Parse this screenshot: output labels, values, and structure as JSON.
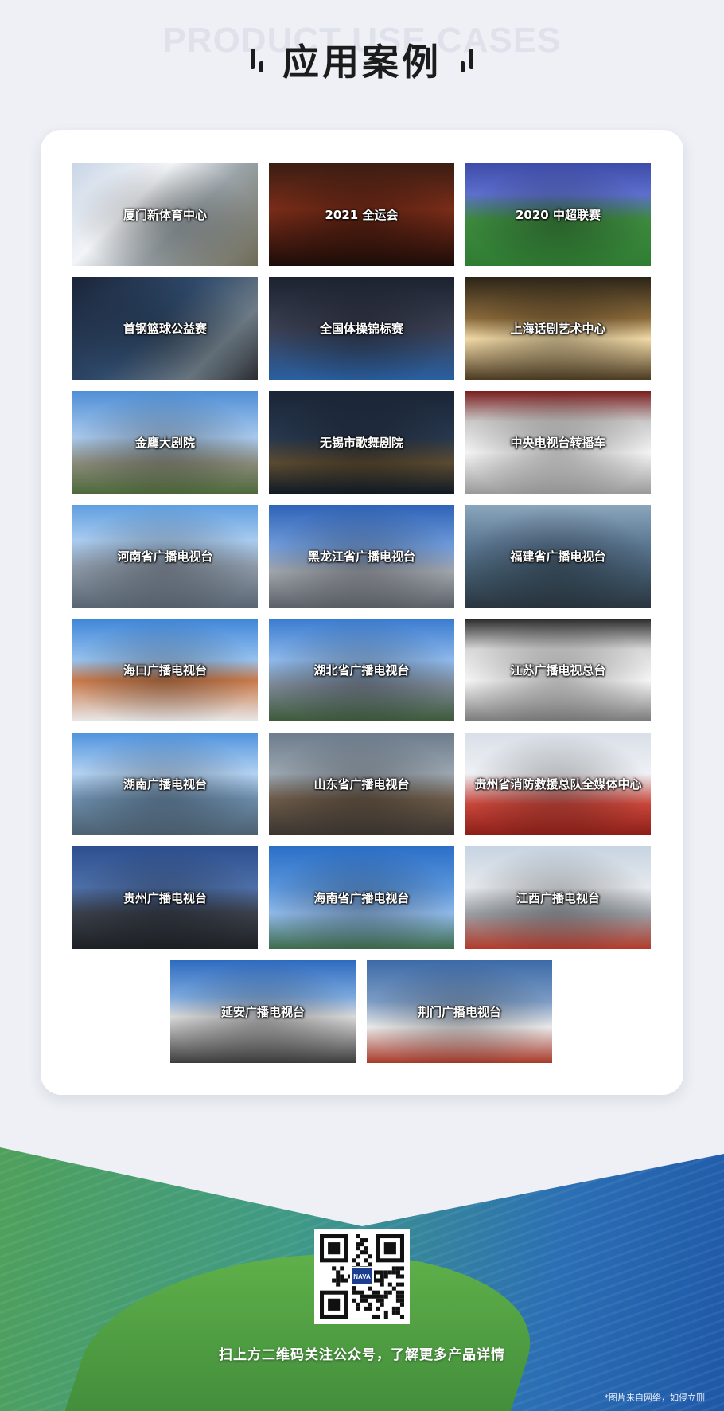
{
  "header": {
    "bg_title": "PRODUCT USE CASES",
    "title": "应用案例"
  },
  "cases": [
    {
      "label": "厦门新体育中心",
      "bg": "linear-gradient(135deg,#c9d6e6 0%,#f2f4f7 35%,#9aa3a8 60%,#6e6a55 100%)",
      "icon": "stadium-photo-icon"
    },
    {
      "label": "2021 全运会",
      "bg": "linear-gradient(180deg,#3b1d12 0%,#7a2c18 45%,#1c0c08 100%)",
      "icon": "national-games-photo-icon"
    },
    {
      "label": "2020 中超联赛",
      "bg": "linear-gradient(180deg,#3e4ca8 0%,#5d6ecd 30%,#3d8a3e 55%,#2f7d33 100%)",
      "icon": "football-match-photo-icon"
    },
    {
      "label": "首钢篮球公益赛",
      "bg": "linear-gradient(135deg,#1b2438 0%,#2f4a6b 45%,#6d7b86 75%,#2a2c30 100%)",
      "icon": "broadcast-console-photo-icon"
    },
    {
      "label": "全国体操锦标赛",
      "bg": "linear-gradient(180deg,#1d2230 0%,#3a3f52 50%,#2a5fa0 100%)",
      "icon": "gymnastics-photo-icon"
    },
    {
      "label": "上海话剧艺术中心",
      "bg": "linear-gradient(180deg,#2b2418 0%,#8b6a3a 40%,#f1d9a6 60%,#4a3a22 100%)",
      "icon": "theater-building-photo-icon"
    },
    {
      "label": "金鹰大剧院",
      "bg": "linear-gradient(180deg,#4f8fd6 0%,#a7c8ec 45%,#8a8a7a 70%,#4d6a3a 100%)",
      "icon": "eagle-statue-photo-icon"
    },
    {
      "label": "无锡市歌舞剧院",
      "bg": "linear-gradient(180deg,#1a2536 0%,#27374d 45%,#5a4a30 70%,#0f1a26 100%)",
      "icon": "night-city-photo-icon"
    },
    {
      "label": "中央电视台转播车",
      "bg": "linear-gradient(180deg,#7a1d1d 0%,#c9c9c9 30%,#f3f3f3 60%,#9a9a9a 100%)",
      "icon": "broadcast-truck-photo-icon"
    },
    {
      "label": "河南省广播电视台",
      "bg": "linear-gradient(180deg,#5f9fe0 0%,#a9cbef 35%,#8d99a8 60%,#5a6572 100%)",
      "icon": "tv-station-building-photo-icon"
    },
    {
      "label": "黑龙江省广播电视台",
      "bg": "linear-gradient(180deg,#2e63b8 0%,#6f9ad8 40%,#9fa4ab 65%,#5c6168 100%)",
      "icon": "tv-tower-photo-icon"
    },
    {
      "label": "福建省广播电视台",
      "bg": "linear-gradient(180deg,#8aa6bd 0%,#5a7590 40%,#3e5566 70%,#2a3540 100%)",
      "icon": "city-skyline-photo-icon"
    },
    {
      "label": "海口广播电视台",
      "bg": "linear-gradient(180deg,#3f86d8 0%,#95c1ee 40%,#c97a4a 60%,#e8e8e8 100%)",
      "icon": "broadcast-truck-photo-icon"
    },
    {
      "label": "湖北省广播电视台",
      "bg": "linear-gradient(180deg,#3a7bd0 0%,#8db8ea 40%,#7a8694 65%,#3d5a3a 100%)",
      "icon": "tv-station-building-photo-icon"
    },
    {
      "label": "江苏广播电视总台",
      "bg": "linear-gradient(180deg,#2a2a2a 0%,#d7d7d7 30%,#f4f4f4 60%,#7a7a7a 100%)",
      "icon": "broadcast-truck-photo-icon"
    },
    {
      "label": "湖南广播电视台",
      "bg": "linear-gradient(180deg,#4f93de 0%,#b3d2f2 40%,#6a8aa8 65%,#4c6070 100%)",
      "icon": "tv-station-building-photo-icon"
    },
    {
      "label": "山东省广播电视台",
      "bg": "linear-gradient(180deg,#6c7c8c 0%,#9aa5b0 40%,#6b5a48 65%,#3a3430 100%)",
      "icon": "tv-station-sign-photo-icon"
    },
    {
      "label": "贵州省消防救援总队全媒体中心",
      "bg": "linear-gradient(180deg,#d9dfe8 0%,#eef1f5 40%,#c8453a 70%,#8a1f18 100%)",
      "icon": "unveiling-ceremony-photo-icon"
    },
    {
      "label": "贵州广播电视台",
      "bg": "linear-gradient(180deg,#2d4f8f 0%,#4d6fa8 40%,#3a3f4a 65%,#1d2024 100%)",
      "icon": "tv-station-building-photo-icon"
    },
    {
      "label": "海南省广播电视台",
      "bg": "linear-gradient(180deg,#2b6fc8 0%,#5a95db 40%,#8fb8e8 65%,#3d6a4a 100%)",
      "icon": "tv-station-building-photo-icon"
    },
    {
      "label": "江西广播电视台",
      "bg": "linear-gradient(180deg,#c7d4e2 0%,#e6e9ed 40%,#9aa0a6 65%,#b23a2a 100%)",
      "icon": "group-photo-icon"
    },
    {
      "label": "延安广播电视台",
      "bg": "linear-gradient(180deg,#2e6bc0 0%,#7aa7dd 35%,#d8d8d8 55%,#3d3d3d 100%)",
      "icon": "round-building-photo-icon"
    },
    {
      "label": "荆门广播电视台",
      "bg": "linear-gradient(180deg,#3c6aa8 0%,#7c9cc4 40%,#e8e8e8 65%,#a83a2a 100%)",
      "icon": "broadcast-truck-photo-icon"
    }
  ],
  "footer": {
    "qr_logo": "NAVA",
    "scan_text": "扫上方二维码关注公众号，了解更多产品详情",
    "disclaimer": "*图片来自网络，如侵立删"
  }
}
